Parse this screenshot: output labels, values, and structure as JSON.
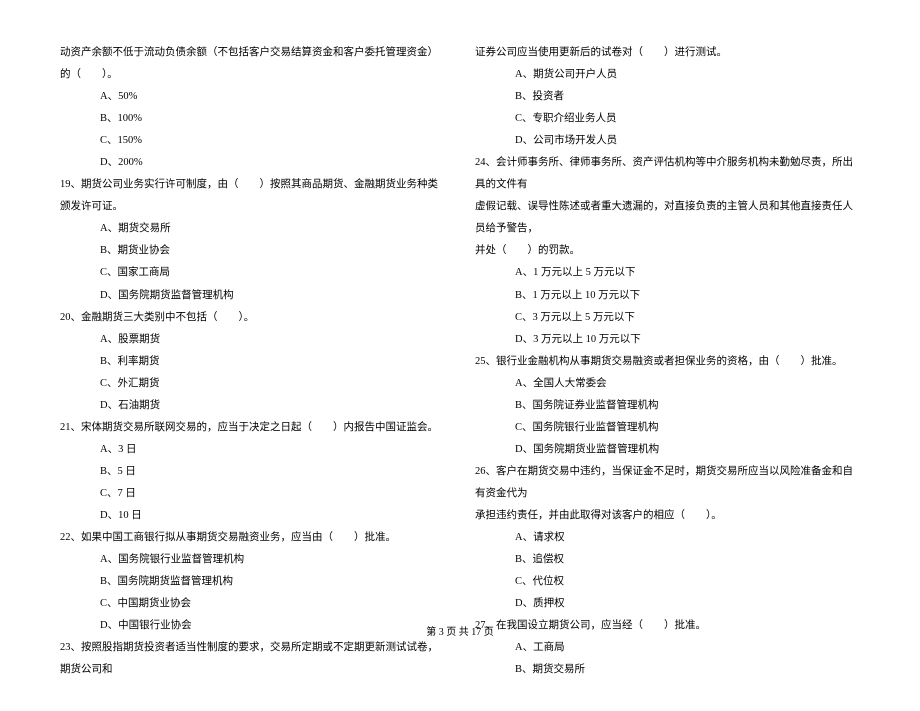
{
  "left": {
    "intro": "动资产余额不低于流动负债余额（不包括客户交易结算资金和客户委托管理资金）的（　　）。",
    "intro_opts": [
      "A、50%",
      "B、100%",
      "C、150%",
      "D、200%"
    ],
    "q19": "19、期货公司业务实行许可制度，由（　　）按照其商品期货、金融期货业务种类颁发许可证。",
    "q19_opts": [
      "A、期货交易所",
      "B、期货业协会",
      "C、国家工商局",
      "D、国务院期货监督管理机构"
    ],
    "q20": "20、金融期货三大类别中不包括（　　）。",
    "q20_opts": [
      "A、股票期货",
      "B、利率期货",
      "C、外汇期货",
      "D、石油期货"
    ],
    "q21": "21、宋体期货交易所联网交易的，应当于决定之日起（　　）内报告中国证监会。",
    "q21_opts": [
      "A、3 日",
      "B、5 日",
      "C、7 日",
      "D、10 日"
    ],
    "q22": "22、如果中国工商银行拟从事期货交易融资业务，应当由（　　）批准。",
    "q22_opts": [
      "A、国务院银行业监督管理机构",
      "B、国务院期货监督管理机构",
      "C、中国期货业协会",
      "D、中国银行业协会"
    ],
    "q23": "23、按照股指期货投资者适当性制度的要求，交易所定期或不定期更新测试试卷，期货公司和"
  },
  "right": {
    "r_intro": "证券公司应当使用更新后的试卷对（　　）进行测试。",
    "r_intro_opts": [
      "A、期货公司开户人员",
      "B、投资者",
      "C、专职介绍业务人员",
      "D、公司市场开发人员"
    ],
    "q24a": "24、会计师事务所、律师事务所、资产评估机构等中介服务机构未勤勉尽责，所出具的文件有",
    "q24b": "虚假记载、误导性陈述或者重大遗漏的，对直接负责的主管人员和其他直接责任人员给予警告，",
    "q24c": "并处（　　）的罚款。",
    "q24_opts": [
      "A、1 万元以上 5 万元以下",
      "B、1 万元以上 10 万元以下",
      "C、3 万元以上 5 万元以下",
      "D、3 万元以上 10 万元以下"
    ],
    "q25": "25、银行业金融机构从事期货交易融资或者担保业务的资格，由（　　）批准。",
    "q25_opts": [
      "A、全国人大常委会",
      "B、国务院证券业监督管理机构",
      "C、国务院银行业监督管理机构",
      "D、国务院期货业监督管理机构"
    ],
    "q26a": "26、客户在期货交易中违约，当保证金不足时，期货交易所应当以风险准备金和自有资金代为",
    "q26b": "承担违约责任，并由此取得对该客户的相应（　　）。",
    "q26_opts": [
      "A、请求权",
      "B、追偿权",
      "C、代位权",
      "D、质押权"
    ],
    "q27": "27、在我国设立期货公司，应当经（　　）批准。",
    "q27_opts": [
      "A、工商局",
      "B、期货交易所"
    ]
  },
  "footer": "第 3 页 共 17 页"
}
